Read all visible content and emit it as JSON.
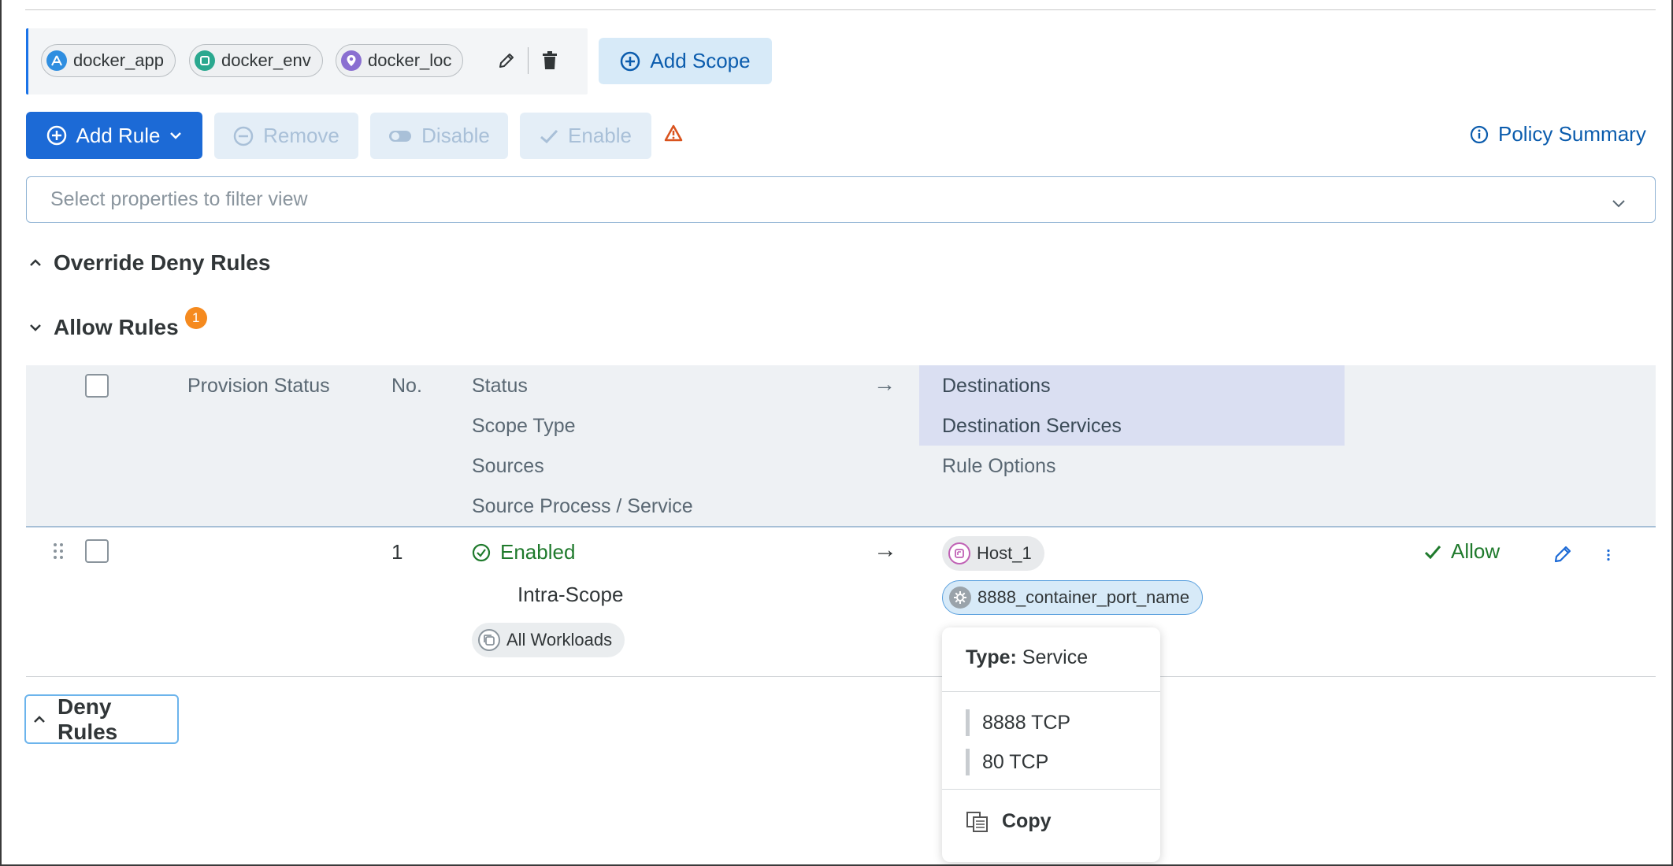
{
  "scope": {
    "labels": [
      {
        "text": "docker_app",
        "icon": "app-label-icon",
        "color": "#2f8ee0"
      },
      {
        "text": "docker_env",
        "icon": "env-label-icon",
        "color": "#2aa88f"
      },
      {
        "text": "docker_loc",
        "icon": "location-label-icon",
        "color": "#8a6fd1"
      }
    ],
    "add_scope_label": "Add Scope"
  },
  "toolbar": {
    "add_rule": "Add Rule",
    "remove": "Remove",
    "disable": "Disable",
    "enable": "Enable",
    "policy_summary": "Policy Summary"
  },
  "filter": {
    "placeholder": "Select properties to filter view"
  },
  "sections": {
    "override_deny": "Override Deny Rules",
    "allow": "Allow Rules",
    "allow_badge": "1",
    "deny": "Deny Rules"
  },
  "table": {
    "headers": {
      "provision_status": "Provision Status",
      "no": "No.",
      "status": "Status",
      "scope_type": "Scope Type",
      "sources": "Sources",
      "source_process": "Source Process / Service",
      "arrow": "→",
      "destinations": "Destinations",
      "destination_services": "Destination Services",
      "rule_options": "Rule Options"
    },
    "rows": [
      {
        "no": "1",
        "status": "Enabled",
        "scope_type": "Intra-Scope",
        "source": "All Workloads",
        "arrow": "→",
        "destination": "Host_1",
        "service": "8888_container_port_name",
        "action": "Allow"
      }
    ]
  },
  "popover": {
    "type_label": "Type:",
    "type_value": "Service",
    "ports": [
      "8888 TCP",
      "80 TCP"
    ],
    "copy": "Copy"
  },
  "colors": {
    "primary": "#1c6ad6",
    "enabled_green": "#1f7a2c",
    "badge_orange": "#f58a1f",
    "link_blue": "#0b5cad"
  }
}
